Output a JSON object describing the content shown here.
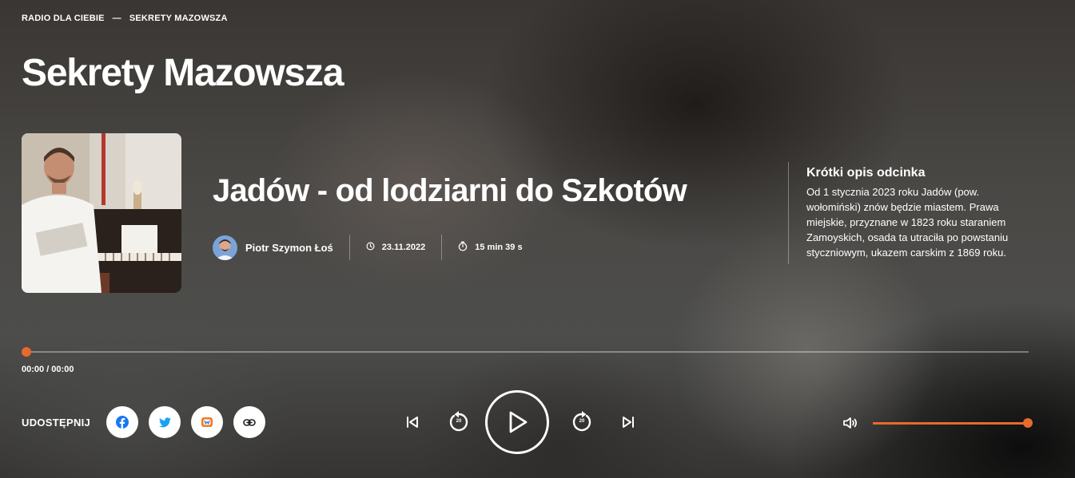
{
  "breadcrumb": {
    "items": [
      "RADIO DLA CIEBIE",
      "SEKRETY MAZOWSZA"
    ],
    "separator": "—"
  },
  "page_title": "Sekrety Mazowsza",
  "episode": {
    "title": "Jadów - od lodziarni do Szkotów",
    "author": "Piotr Szymon Łoś",
    "date": "23.11.2022",
    "duration": "15 min 39 s"
  },
  "description": {
    "heading": "Krótki opis odcinka",
    "text": "Od 1 stycznia 2023 roku Jadów (pow. wołomiński) znów będzie miastem. Prawa miejskie, przyznane w 1823 roku staraniem Zamoyskich, osada ta utraciła po powstaniu styczniowym, ukazem carskim z 1869 roku."
  },
  "player": {
    "time_display": "00:00 / 00:00",
    "progress": 0,
    "skip_back_seconds": "20",
    "skip_forward_seconds": "20",
    "volume": 1.0,
    "accent_color": "#e8692c"
  },
  "share": {
    "label": "UDOSTĘPNIJ",
    "buttons": [
      "facebook-icon",
      "twitter-icon",
      "wykop-icon",
      "link-icon"
    ]
  },
  "icons": {
    "date": "clock-icon",
    "duration": "stopwatch-icon",
    "prev": "skip-previous-icon",
    "rewind": "rewind-20-icon",
    "play": "play-icon",
    "forward": "forward-20-icon",
    "next": "skip-next-icon",
    "volume": "volume-icon"
  }
}
